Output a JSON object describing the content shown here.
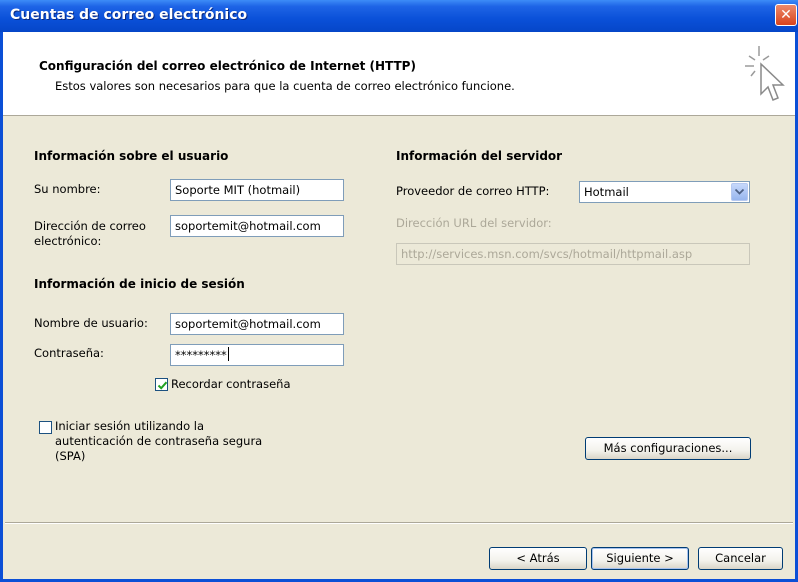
{
  "window": {
    "title": "Cuentas de correo electrónico"
  },
  "header": {
    "title": "Configuración del correo electrónico de Internet (HTTP)",
    "subtitle": "Estos valores son necesarios para que la cuenta de correo electrónico funcione."
  },
  "user_info": {
    "section_title": "Información sobre el usuario",
    "name_label": "Su nombre:",
    "name_value": "Soporte MIT (hotmail)",
    "email_label_1": "Dirección de correo",
    "email_label_2": "electrónico:",
    "email_value": "soportemit@hotmail.com"
  },
  "login_info": {
    "section_title": "Información de inicio de sesión",
    "username_label": "Nombre de usuario:",
    "username_value": "soportemit@hotmail.com",
    "password_label": "Contraseña:",
    "password_value": "*********",
    "remember_label": "Recordar contraseña",
    "remember_checked": true,
    "spa_label_1": "Iniciar sesión utilizando la",
    "spa_label_2": "autenticación de contraseña segura",
    "spa_label_3": "(SPA)",
    "spa_checked": false
  },
  "server_info": {
    "section_title": "Información del servidor",
    "provider_label": "Proveedor de correo HTTP:",
    "provider_value": "Hotmail",
    "url_label": "Dirección URL del servidor:",
    "url_value": "http://services.msn.com/svcs/hotmail/httpmail.asp"
  },
  "buttons": {
    "more_settings": "Más configuraciones...",
    "back": "< Atrás",
    "next": "Siguiente >",
    "cancel": "Cancelar"
  },
  "icons": {
    "close": "close-icon",
    "wizard": "cursor-sparkle-icon",
    "dropdown": "chevron-down-icon",
    "check": "checkmark-icon"
  },
  "colors": {
    "titlebar": "#0a50d8",
    "dialog_bg": "#ece9d8",
    "header_bg": "#ffffff",
    "disabled_text": "#aca899"
  }
}
